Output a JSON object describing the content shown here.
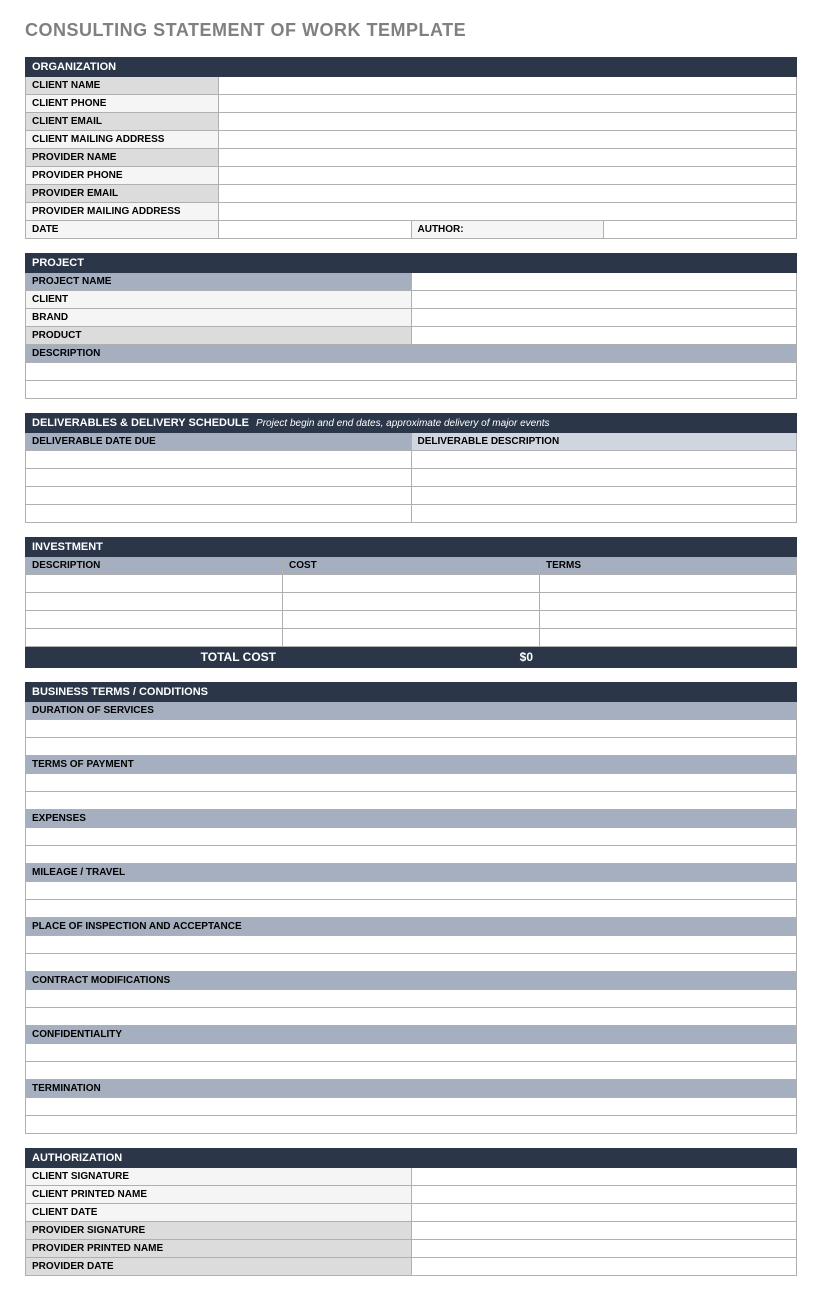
{
  "title": "CONSULTING STATEMENT OF WORK TEMPLATE",
  "organization": {
    "header": "ORGANIZATION",
    "rows": [
      {
        "label": "CLIENT NAME",
        "shade": "med"
      },
      {
        "label": "CLIENT  PHONE",
        "shade": "light"
      },
      {
        "label": "CLIENT EMAIL",
        "shade": "med"
      },
      {
        "label": "CLIENT MAILING ADDRESS",
        "shade": "light"
      },
      {
        "label": "PROVIDER NAME",
        "shade": "med"
      },
      {
        "label": "PROVIDER PHONE",
        "shade": "light"
      },
      {
        "label": "PROVIDER EMAIL",
        "shade": "med"
      },
      {
        "label": "PROVIDER MAILING ADDRESS",
        "shade": "light"
      }
    ],
    "date_label": "DATE",
    "author_label": "AUTHOR:"
  },
  "project": {
    "header": "PROJECT",
    "rows": [
      {
        "label": "PROJECT NAME",
        "shade": "blue-med"
      },
      {
        "label": "CLIENT",
        "shade": "light"
      },
      {
        "label": "BRAND",
        "shade": "light"
      },
      {
        "label": "PRODUCT",
        "shade": "med"
      }
    ],
    "description_label": "DESCRIPTION"
  },
  "deliverables": {
    "header": "DELIVERABLES & DELIVERY SCHEDULE",
    "hint": "Project begin and end dates, approximate delivery of major events",
    "col1": "DELIVERABLE DATE DUE",
    "col2": "DELIVERABLE DESCRIPTION"
  },
  "investment": {
    "header": "INVESTMENT",
    "col1": "DESCRIPTION",
    "col2": "COST",
    "col3": "TERMS",
    "total_label": "TOTAL COST",
    "total_value": "$0"
  },
  "terms": {
    "header": "BUSINESS TERMS / CONDITIONS",
    "items": [
      "DURATION OF SERVICES",
      "TERMS OF PAYMENT",
      "EXPENSES",
      "MILEAGE / TRAVEL",
      "PLACE OF INSPECTION AND ACCEPTANCE",
      "CONTRACT MODIFICATIONS",
      "CONFIDENTIALITY",
      "TERMINATION"
    ]
  },
  "authorization": {
    "header": "AUTHORIZATION",
    "rows": [
      {
        "label": "CLIENT SIGNATURE",
        "shade": "light"
      },
      {
        "label": "CLIENT PRINTED NAME",
        "shade": "light"
      },
      {
        "label": "CLIENT DATE",
        "shade": "light"
      },
      {
        "label": "PROVIDER SIGNATURE",
        "shade": "med"
      },
      {
        "label": "PROVIDER PRINTED NAME",
        "shade": "med"
      },
      {
        "label": "PROVIDER DATE",
        "shade": "med"
      }
    ]
  }
}
